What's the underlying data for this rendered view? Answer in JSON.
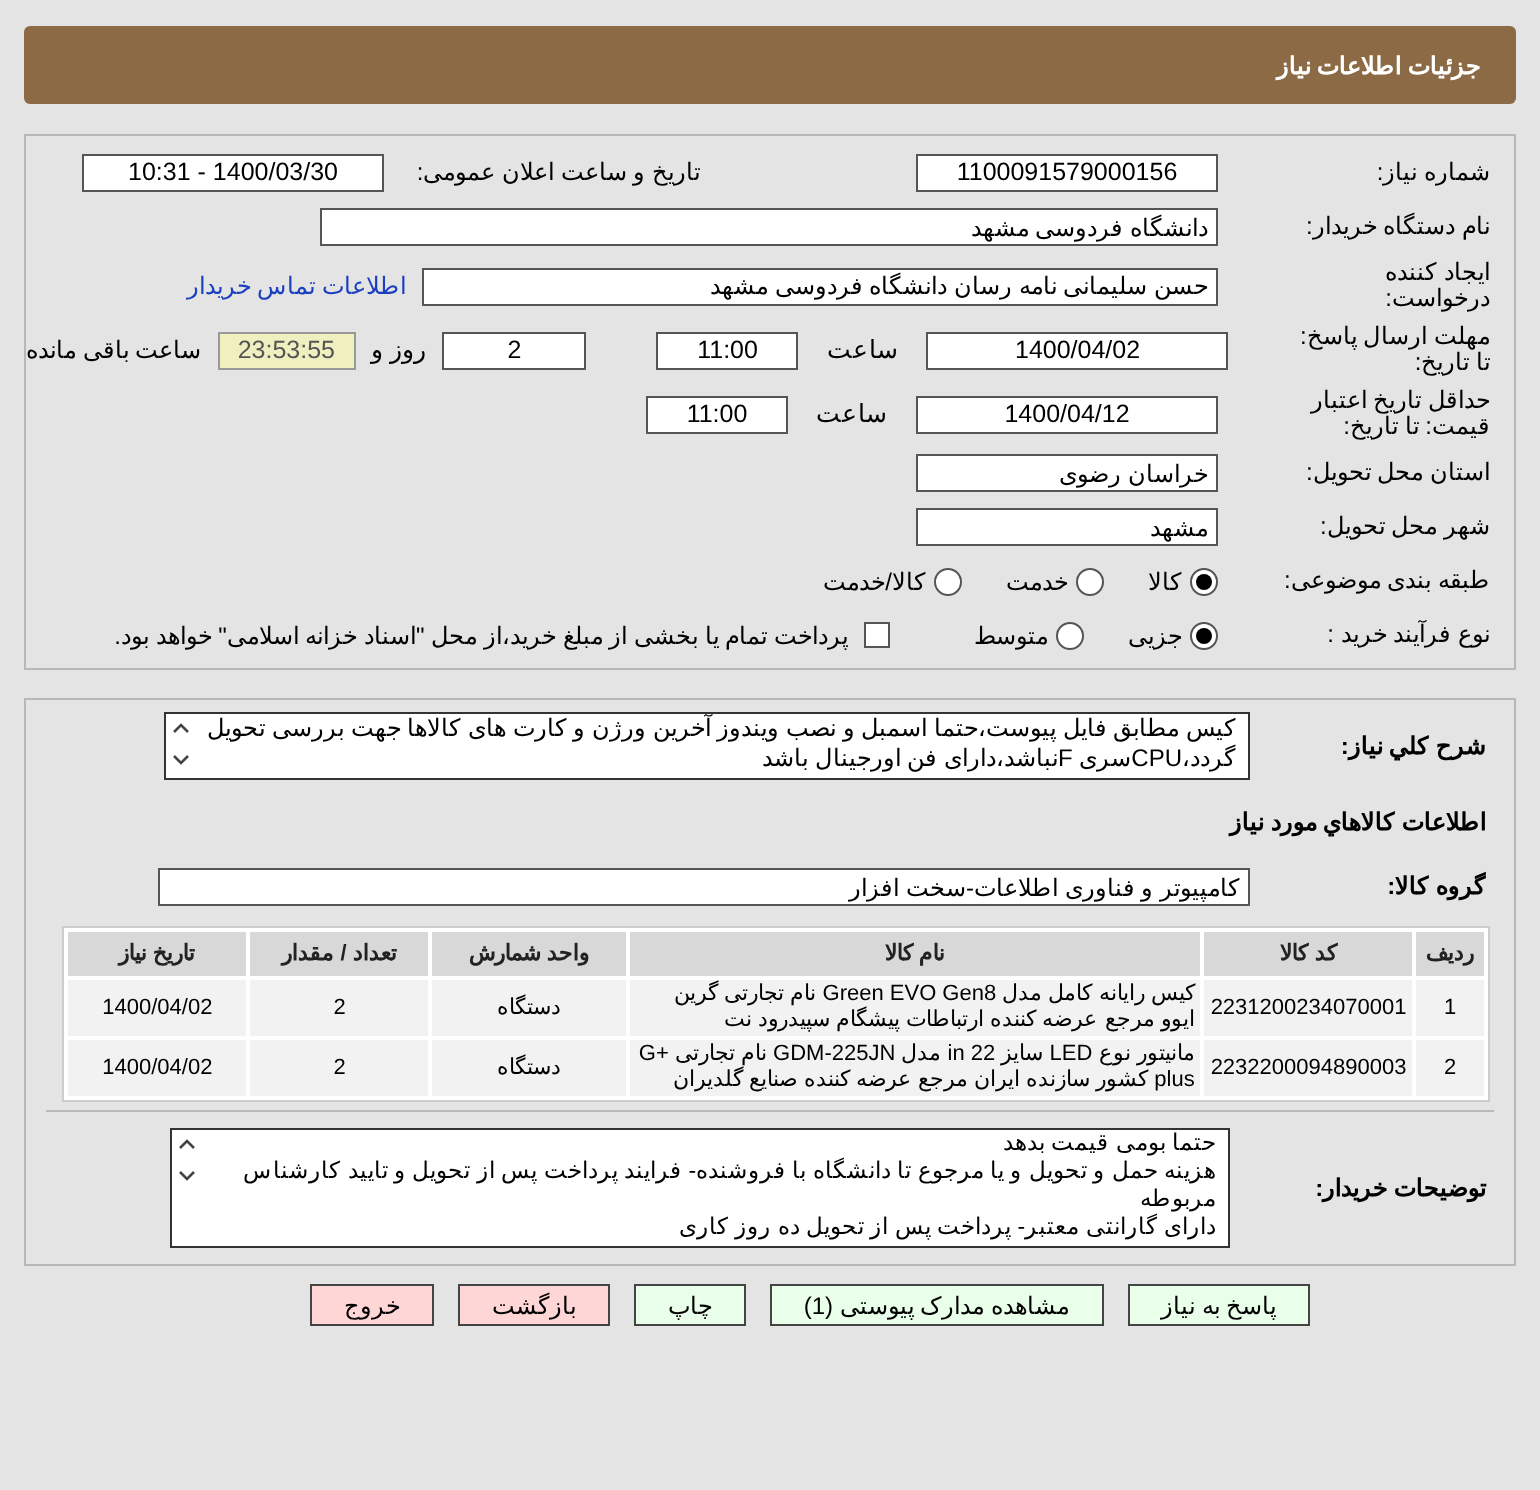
{
  "header": {
    "title": "جزئیات اطلاعات نیاز"
  },
  "details": {
    "need_number": {
      "label": "شماره نیاز:",
      "value": "1100091579000156"
    },
    "announce": {
      "label": "تاریخ و ساعت اعلان عمومی:",
      "value": "1400/03/30 - 10:31"
    },
    "buyer": {
      "label": "نام دستگاه خریدار:",
      "value": "دانشگاه فردوسی مشهد"
    },
    "creator": {
      "label": "ایجاد کننده درخواست:",
      "value": "حسن سلیمانی نامه رسان دانشگاه فردوسی مشهد",
      "link": "اطلاعات تماس خریدار"
    },
    "deadline": {
      "label": "مهلت ارسال پاسخ: تا تاریخ:",
      "date": "1400/04/02",
      "time_label": "ساعت",
      "time": "11:00",
      "days": "2",
      "days_label": "روز و",
      "countdown": "23:53:55",
      "remaining_label": "ساعت باقی مانده"
    },
    "validity": {
      "label": "حداقل تاریخ اعتبار قیمت: تا تاریخ:",
      "date": "1400/04/12",
      "time_label": "ساعت",
      "time": "11:00"
    },
    "province": {
      "label": "استان محل تحویل:",
      "value": "خراسان رضوی"
    },
    "city": {
      "label": "شهر محل تحویل:",
      "value": "مشهد"
    },
    "category": {
      "label": "طبقه بندی موضوعی:",
      "options": [
        {
          "label": "کالا",
          "selected": true
        },
        {
          "label": "خدمت",
          "selected": false
        },
        {
          "label": "کالا/خدمت",
          "selected": false
        }
      ]
    },
    "process": {
      "label": "نوع فرآیند خرید :",
      "options": [
        {
          "label": "جزیی",
          "selected": true
        },
        {
          "label": "متوسط",
          "selected": false
        }
      ],
      "treasury": {
        "label": "پرداخت تمام یا بخشی از مبلغ خرید،از محل \"اسناد خزانه اسلامی\" خواهد بود.",
        "checked": false
      }
    }
  },
  "description": {
    "label": "شرح کلي نياز:",
    "text": "کیس مطابق فایل پیوست،حتما اسمبل و نصب ویندوز آخرین ورژن و کارت های کالاها جهت بررسی تحویل گردد،CPUسری Fنباشد،دارای فن اورجینال باشد"
  },
  "items_heading": "اطلاعات کالاهاي مورد نياز",
  "goods_group": {
    "label": "گروه کالا:",
    "value": "کامپیوتر و فناوری اطلاعات-سخت افزار"
  },
  "table": {
    "columns": [
      "ردیف",
      "کد کالا",
      "نام کالا",
      "واحد شمارش",
      "تعداد / مقدار",
      "تاریخ نیاز"
    ],
    "rows": [
      [
        "1",
        "2231200234070001",
        "کیس رایانه کامل مدل Green EVO Gen8 نام تجارتی گرین ایوو مرجع عرضه کننده ارتباطات پیشگام سپیدرود نت",
        "دستگاه",
        "2",
        "1400/04/02"
      ],
      [
        "2",
        "2232200094890003",
        "مانیتور نوع LED سایز 22 in مدل GDM-225JN نام تجارتی G+ plus کشور سازنده ایران مرجع عرضه کننده صنایع گلدیران",
        "دستگاه",
        "2",
        "1400/04/02"
      ]
    ]
  },
  "buyer_notes": {
    "label": "توضیحات خریدار:",
    "lines": [
      "حتما بومی قیمت بدهد",
      "هزینه حمل و تحویل و یا مرجوع تا دانشگاه با فروشنده- فرایند پرداخت پس از تحویل و تایید کارشناس مربوطه",
      "دارای گارانتی معتبر- پرداخت پس از تحویل ده روز کاری"
    ]
  },
  "buttons": [
    {
      "label": "پاسخ به نیاز",
      "kind": "primary"
    },
    {
      "label": "مشاهده مدارک پیوستی (1)",
      "kind": "primary"
    },
    {
      "label": "چاپ",
      "kind": "primary"
    },
    {
      "label": "بازگشت",
      "kind": "danger"
    },
    {
      "label": "خروج",
      "kind": "danger"
    }
  ]
}
